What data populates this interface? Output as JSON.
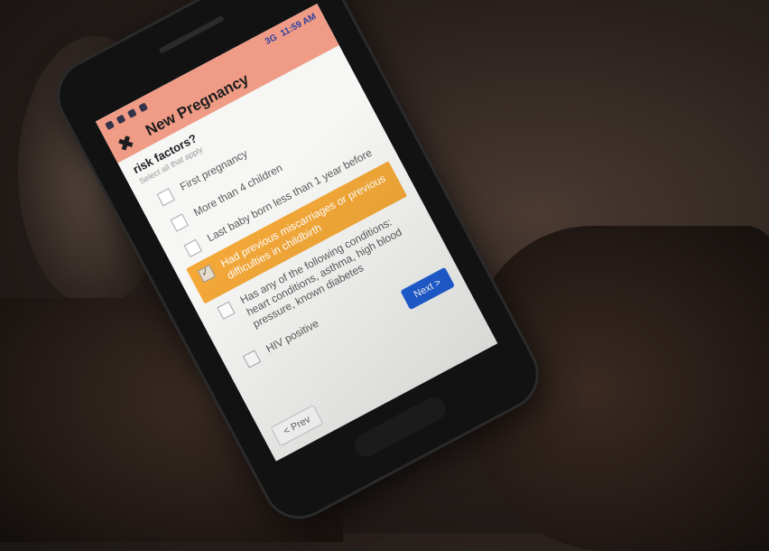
{
  "status_bar": {
    "network": "3G",
    "time": "11:59 AM"
  },
  "app_bar": {
    "close_icon": "close-icon",
    "title": "New Pregnancy"
  },
  "question": {
    "title": "risk factors?",
    "hint": "Select all that apply"
  },
  "options": [
    {
      "label": "First pregnancy",
      "checked": false
    },
    {
      "label": "More than 4 children",
      "checked": false
    },
    {
      "label": "Last baby born less than 1 year before",
      "checked": false
    },
    {
      "label": "Had previous miscarriages or previous difficulties in childbirth",
      "checked": true
    },
    {
      "label": "Has any of the following conditions: heart conditions, asthma, high blood pressure, known diabetes",
      "checked": false
    },
    {
      "label": "HIV positive",
      "checked": false
    }
  ],
  "navigation": {
    "prev_label": "< Prev",
    "next_label": "Next >"
  },
  "colors": {
    "app_bar": "#ef9b86",
    "selected_option": "#f3a838",
    "next_button": "#1f5fd6"
  }
}
